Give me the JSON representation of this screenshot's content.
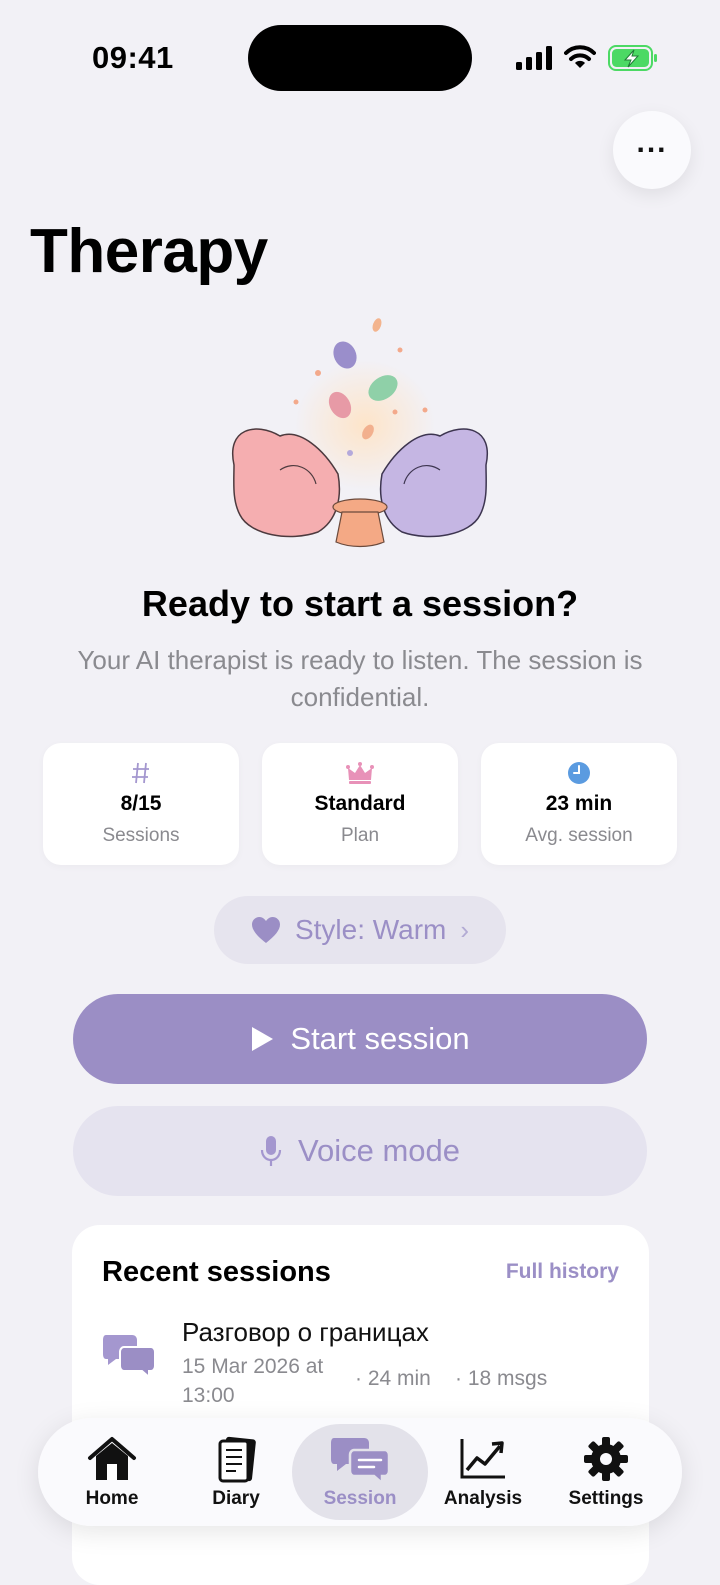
{
  "status_bar": {
    "time": "09:41"
  },
  "page": {
    "title": "Therapy"
  },
  "hero": {
    "heading": "Ready to start a session?",
    "subtext": "Your AI therapist is ready to listen. The session is confidential."
  },
  "stats": [
    {
      "icon": "hash-icon",
      "value": "8/15",
      "label": "Sessions"
    },
    {
      "icon": "crown-icon",
      "value": "Standard",
      "label": "Plan"
    },
    {
      "icon": "clock-icon",
      "value": "23 min",
      "label": "Avg. session"
    }
  ],
  "style_chip": {
    "label": "Style: Warm",
    "icon": "heart-icon"
  },
  "actions": {
    "start_label": "Start session",
    "voice_label": "Voice mode"
  },
  "recent": {
    "title": "Recent sessions",
    "full_history": "Full history",
    "sessions": [
      {
        "title": "Разговор о границах",
        "date": "15 Mar 2026 at 13:00",
        "duration": "· 24 min",
        "messages": "· 18 msgs"
      }
    ]
  },
  "tabs": [
    {
      "label": "Home",
      "icon": "home-icon"
    },
    {
      "label": "Diary",
      "icon": "notebook-icon"
    },
    {
      "label": "Session",
      "icon": "chat-bubbles-icon",
      "active": true
    },
    {
      "label": "Analysis",
      "icon": "chart-line-icon"
    },
    {
      "label": "Settings",
      "icon": "gear-icon"
    }
  ],
  "colors": {
    "accent": "#9b8ec5",
    "accent_soft": "#e5e3ef",
    "background": "#f2f1f6",
    "battery": "#4cd964"
  }
}
